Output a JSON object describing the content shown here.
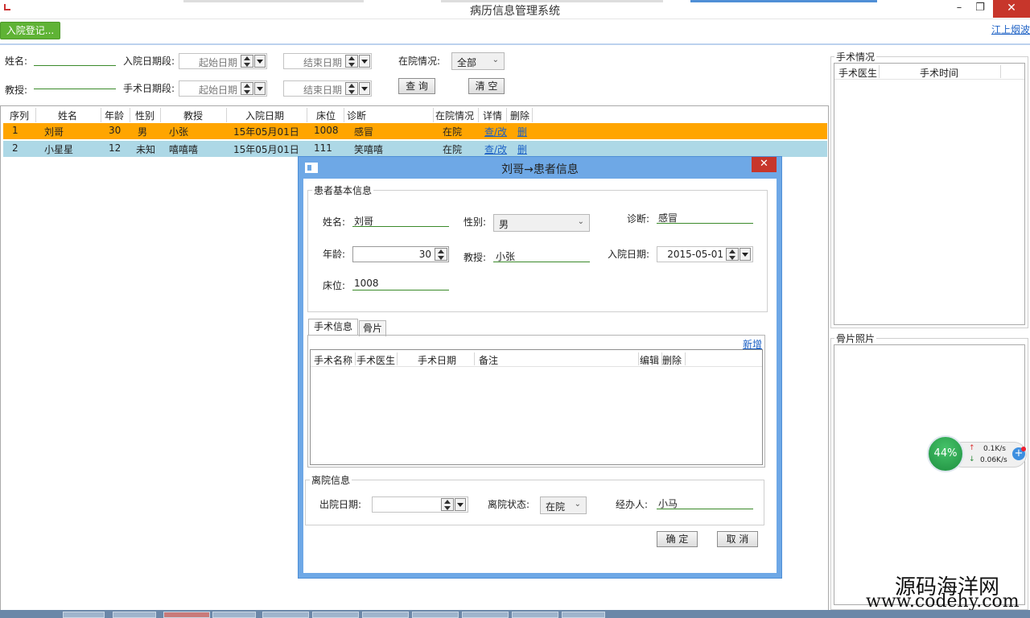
{
  "window": {
    "title": "病历信息管理系统",
    "minimize": "–",
    "maximize": "❐",
    "close": "✕"
  },
  "toolbar": {
    "admit_button": "入院登记...",
    "user_link": "江上烟波"
  },
  "filters": {
    "name_label": "姓名:",
    "admit_period_label": "入院日期段:",
    "start_date_placeholder": "起始日期",
    "end_date_placeholder": "结束日期",
    "status_label": "在院情况:",
    "status_value": "全部",
    "professor_label": "教授:",
    "surgery_period_label": "手术日期段:",
    "search_button": "查 询",
    "clear_button": "清 空"
  },
  "grid": {
    "columns": [
      "序列",
      "姓名",
      "年龄",
      "性别",
      "教授",
      "入院日期",
      "床位",
      "诊断",
      "在院情况",
      "详情",
      "删除"
    ],
    "rows": [
      {
        "seq": "1",
        "name": "刘哥",
        "age": "30",
        "gender": "男",
        "professor": "小张",
        "admit_date": "15年05月01日",
        "bed": "1008",
        "diagnosis": "感冒",
        "status": "在院",
        "detail": "查/改",
        "delete": "删"
      },
      {
        "seq": "2",
        "name": "小星星",
        "age": "12",
        "gender": "未知",
        "professor": "嘻嘻嘻",
        "admit_date": "15年05月01日",
        "bed": "111",
        "diagnosis": "笑嘻嘻",
        "status": "在院",
        "detail": "查/改",
        "delete": "删"
      }
    ]
  },
  "surgery_panel": {
    "title": "手术情况",
    "columns": [
      "手术医生",
      "手术时间"
    ]
  },
  "xray_panel": {
    "title": "骨片照片"
  },
  "dialog": {
    "title": "刘哥→患者信息",
    "close": "✕",
    "basic_group": "患者基本信息",
    "name_label": "姓名:",
    "name_value": "刘哥",
    "gender_label": "性别:",
    "gender_value": "男",
    "diagnosis_label": "诊断:",
    "diagnosis_value": "感冒",
    "age_label": "年龄:",
    "age_value": "30",
    "professor_label": "教授:",
    "professor_value": "小张",
    "admit_date_label": "入院日期:",
    "admit_date_value": "2015-05-01",
    "bed_label": "床位:",
    "bed_value": "1008",
    "tabs": [
      "手术信息",
      "骨片"
    ],
    "add_link": "新增",
    "surgery_columns": [
      "手术名称",
      "手术医生",
      "手术日期",
      "备注",
      "编辑",
      "删除"
    ],
    "discharge_group": "离院信息",
    "discharge_date_label": "出院日期:",
    "discharge_status_label": "离院状态:",
    "discharge_status_value": "在院",
    "handler_label": "经办人:",
    "handler_value": "小马",
    "ok_button": "确 定",
    "cancel_button": "取 消"
  },
  "speed_widget": {
    "percent": "44%",
    "up": "0.1K/s",
    "down": "0.06K/s"
  },
  "watermark": {
    "line1": "源码海洋网",
    "line2": "www.codehy.com"
  }
}
